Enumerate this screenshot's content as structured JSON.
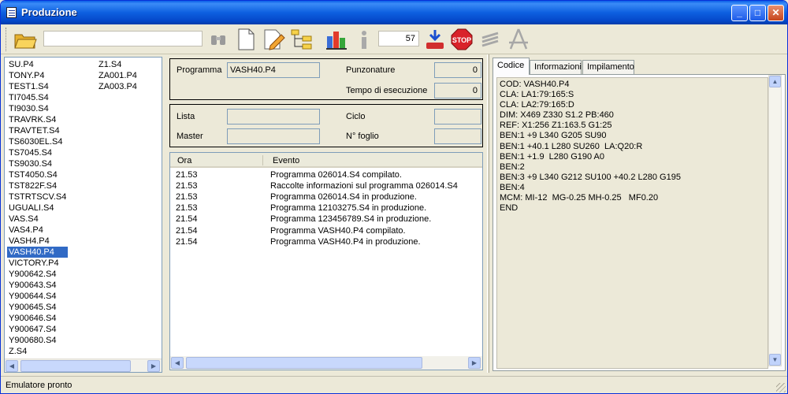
{
  "window": {
    "title": "Produzione",
    "min": "_",
    "max": "□",
    "close": "✕"
  },
  "toolbar": {
    "search_value": "",
    "count": "57"
  },
  "filelist": {
    "col1": [
      "SU.P4",
      "TONY.P4",
      "TEST1.S4",
      "TI7045.S4",
      "TI9030.S4",
      "TRAVRK.S4",
      "TRAVTET.S4",
      "TS6030EL.S4",
      "TS7045.S4",
      "TS9030.S4",
      "TST4050.S4",
      "TST822F.S4",
      "TSTRTSCV.S4",
      "UGUALI.S4",
      "VAS.S4",
      "VAS4.P4",
      "VASH4.P4",
      "VASH40.P4",
      "VICTORY.P4",
      "Y900642.S4",
      "Y900643.S4",
      "Y900644.S4",
      "Y900645.S4",
      "Y900646.S4",
      "Y900647.S4",
      "Y900680.S4",
      "Z.S4"
    ],
    "col2": [
      "Z1.S4",
      "ZA001.P4",
      "ZA003.P4"
    ],
    "selected": "VASH40.P4"
  },
  "info": {
    "programma_label": "Programma",
    "programma_value": "VASH40.P4",
    "punzonature_label": "Punzonature",
    "punzonature_value": "0",
    "tempo_label": "Tempo di esecuzione",
    "tempo_value": "0",
    "lista_label": "Lista",
    "lista_value": "",
    "ciclo_label": "Ciclo",
    "ciclo_value": "",
    "master_label": "Master",
    "master_value": "",
    "foglio_label": "N° foglio",
    "foglio_value": ""
  },
  "log": {
    "headers": {
      "ora": "Ora",
      "evento": "Evento"
    },
    "rows": [
      {
        "ora": "21.53",
        "evento": "Programma 026014.S4 compilato."
      },
      {
        "ora": "21.53",
        "evento": "Raccolte informazioni sul programma 026014.S4"
      },
      {
        "ora": "21.53",
        "evento": "Programma 026014.S4 in produzione."
      },
      {
        "ora": "21.53",
        "evento": "Programma 12103275.S4 in produzione."
      },
      {
        "ora": "21.54",
        "evento": "Programma 123456789.S4 in produzione."
      },
      {
        "ora": "21.54",
        "evento": "Programma VASH40.P4 compilato."
      },
      {
        "ora": "21.54",
        "evento": "Programma VASH40.P4 in produzione."
      }
    ]
  },
  "tabs": [
    {
      "label": "Codice"
    },
    {
      "label": "Informazioni"
    },
    {
      "label": "Impilamento"
    }
  ],
  "code": [
    "COD: VASH40.P4",
    "CLA: LA1:79:165:S",
    "CLA: LA2:79:165:D",
    "DIM: X469 Z330 S1.2 PB:460",
    "REF: X1:256 Z1:163.5 G1:25",
    "BEN:1 +9 L340 G205 SU90",
    "BEN:1 +40.1 L280 SU260  LA:Q20:R",
    "BEN:1 +1.9  L280 G190 A0",
    "BEN:2",
    "BEN:3 +9 L340 G212 SU100 +40.2 L280 G195",
    "BEN:4",
    "MCM: MI-12  MG-0.25 MH-0.25   MF0.20",
    "END"
  ],
  "status": {
    "text": "Emulatore pronto"
  },
  "colors": {
    "titlebar": "#0a5ee8",
    "selection": "#316ac5",
    "face": "#ece9d8"
  }
}
